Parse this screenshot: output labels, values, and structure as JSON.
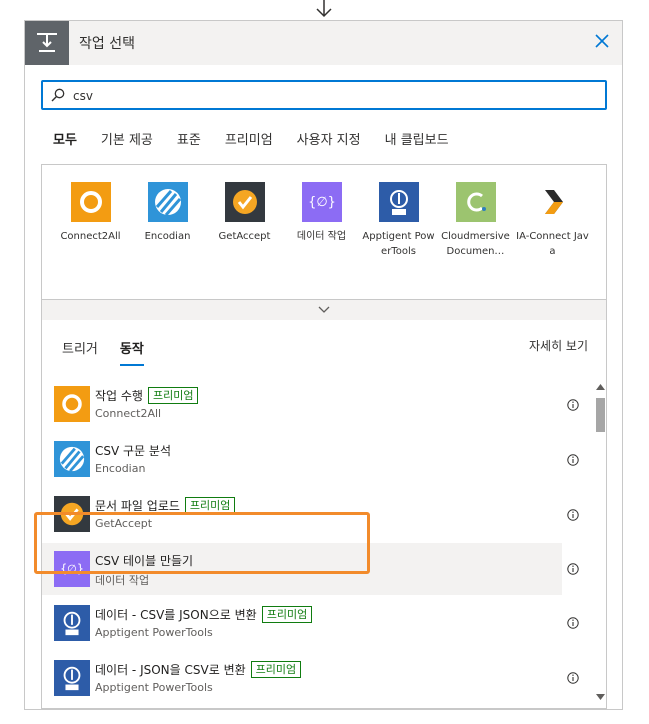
{
  "header": {
    "title": "작업 선택"
  },
  "search": {
    "value": "csv",
    "placeholder": ""
  },
  "category_tabs": [
    "모두",
    "기본 제공",
    "표준",
    "프리미엄",
    "사용자 지정",
    "내 클립보드"
  ],
  "connectors": [
    {
      "name": "Connect2All",
      "icon": "connect2all-ring-icon",
      "color": "#f39c12"
    },
    {
      "name": "Encodian",
      "icon": "encodian-stripes-icon",
      "color": "#2f94d8"
    },
    {
      "name": "GetAccept",
      "icon": "getaccept-check-icon",
      "color": "#33393f"
    },
    {
      "name": "데이터 작업",
      "icon": "data-operation-icon",
      "color": "#8c6cf4"
    },
    {
      "name": "Apptigent PowerTools",
      "icon": "apptigent-pro-icon",
      "color": "#2d5ca8"
    },
    {
      "name": "Cloudmersive Documen…",
      "icon": "cloudmersive-c-icon",
      "color": "#9cc46f"
    },
    {
      "name": "IA-Connect Java",
      "icon": "ia-connect-chevron-icon",
      "color": "#2b2b2b"
    }
  ],
  "action_tabs": [
    "트리거",
    "동작"
  ],
  "details_label": "자세히 보기",
  "premium_label": "프리미엄",
  "actions": [
    {
      "title": "작업 수행",
      "subtitle": "Connect2All",
      "premium": true
    },
    {
      "title": "CSV 구문 분석",
      "subtitle": "Encodian",
      "premium": false
    },
    {
      "title": "문서 파일 업로드",
      "subtitle": "GetAccept",
      "premium": true
    },
    {
      "title": "CSV 테이블 만들기",
      "subtitle": "데이터 작업",
      "premium": false
    },
    {
      "title": "데이터 - CSV를 JSON으로 변환",
      "subtitle": "Apptigent PowerTools",
      "premium": true
    },
    {
      "title": "데이터 - JSON을 CSV로 변환",
      "subtitle": "Apptigent PowerTools",
      "premium": true
    }
  ],
  "colors": {
    "accent": "#0078d4",
    "premium": "#107c10",
    "highlight": "#f28b2b"
  }
}
